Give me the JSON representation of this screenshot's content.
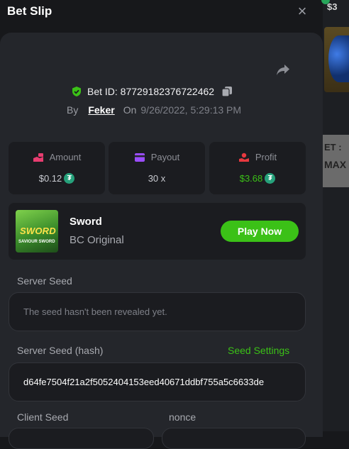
{
  "window": {
    "title": "Bet Slip",
    "close_label": "×"
  },
  "bet": {
    "id_text": "Bet ID: 87729182376722462",
    "by_label": "By",
    "user": "Feker",
    "on_label": "On",
    "date": "9/26/2022, 5:29:13 PM"
  },
  "stats": {
    "amount": {
      "label": "Amount",
      "value": "$0.12"
    },
    "payout": {
      "label": "Payout",
      "value": "30 x"
    },
    "profit": {
      "label": "Profit",
      "value": "$3.68"
    }
  },
  "game": {
    "name": "Sword",
    "provider": "BC Original",
    "thumb_title": "SWORD",
    "thumb_subtitle": "SAVIOUR SWORD",
    "play_label": "Play Now"
  },
  "seeds": {
    "server_seed_label": "Server Seed",
    "server_seed_placeholder": "The seed hasn't been revealed yet.",
    "server_hash_label": "Server Seed (hash)",
    "seed_settings_label": "Seed Settings",
    "server_hash_value": "d64fe7504f21a2f5052404153eed40671ddbf755a5c6633de",
    "client_seed_label": "Client Seed",
    "nonce_label": "nonce"
  },
  "background_game": {
    "top_text": "$3",
    "banner_line1": "ET :",
    "banner_line2": "MAX"
  },
  "colors": {
    "accent_green": "#3bc117",
    "panel": "#24262b",
    "card": "#1b1c20",
    "page": "#17181b",
    "tether": "#26a17b"
  },
  "icons": {
    "shield": "shield-check-icon",
    "copy": "copy-icon",
    "share": "share-icon",
    "amount": "money-hand-icon",
    "payout": "card-icon",
    "profit": "profit-hand-icon",
    "coin": "tether-coin-icon"
  }
}
